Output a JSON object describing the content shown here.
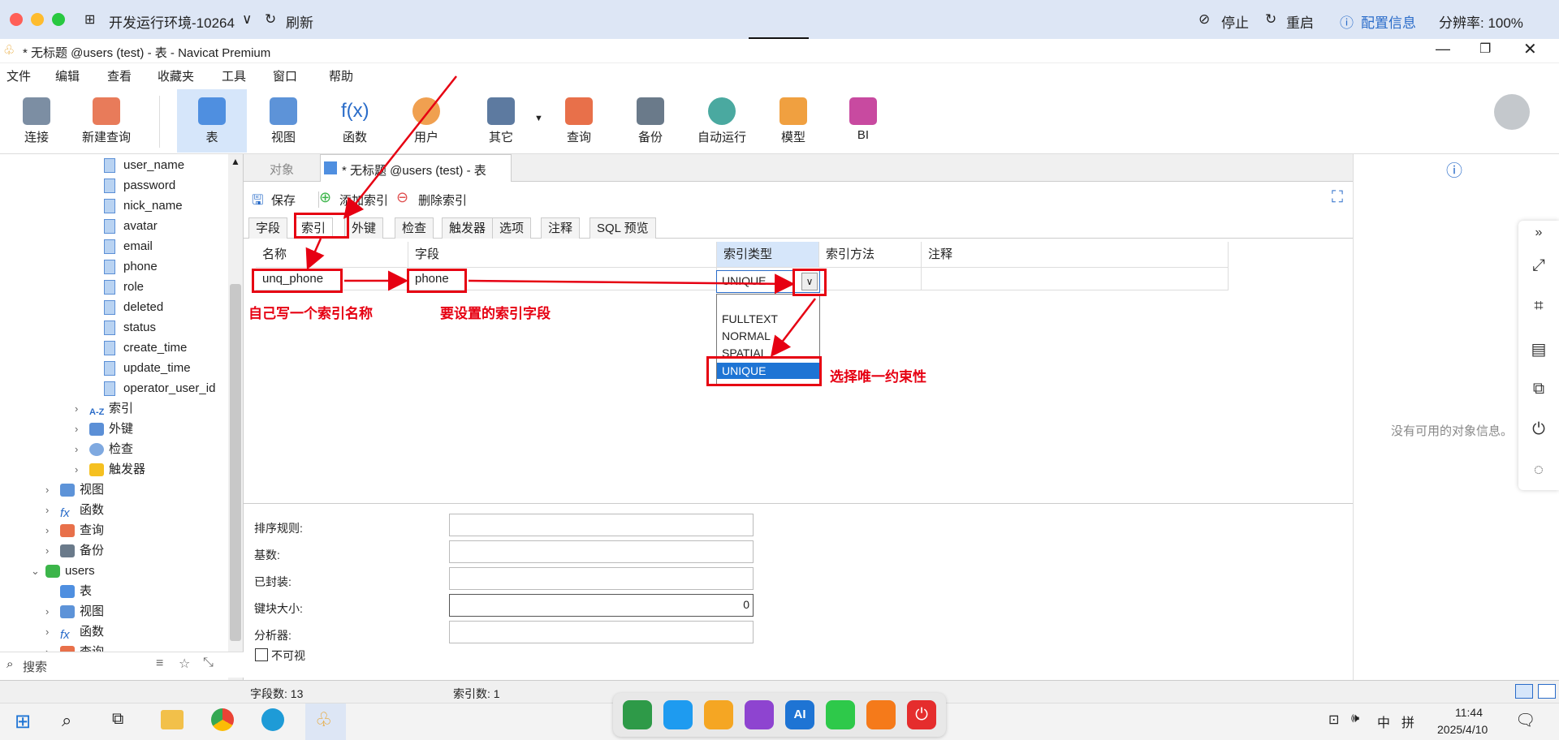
{
  "topbar": {
    "env": "开发运行环境-10264",
    "refresh": "刷新",
    "stop": "停止",
    "restart": "重启",
    "config": "配置信息",
    "resolution": "分辨率: 100%"
  },
  "window": {
    "title": "* 无标题 @users (test) - 表 - Navicat Premium"
  },
  "menu": [
    "文件",
    "编辑",
    "查看",
    "收藏夹",
    "工具",
    "窗口",
    "帮助"
  ],
  "toolbar": [
    {
      "label": "连接",
      "icon": "connect-icon"
    },
    {
      "label": "新建查询",
      "icon": "new-query-icon"
    },
    {
      "label": "表",
      "icon": "table-icon"
    },
    {
      "label": "视图",
      "icon": "view-icon"
    },
    {
      "label": "函数",
      "icon": "function-icon"
    },
    {
      "label": "用户",
      "icon": "user-icon"
    },
    {
      "label": "其它",
      "icon": "tools-icon"
    },
    {
      "label": "查询",
      "icon": "query-icon"
    },
    {
      "label": "备份",
      "icon": "backup-icon"
    },
    {
      "label": "自动运行",
      "icon": "robot-icon"
    },
    {
      "label": "模型",
      "icon": "model-icon"
    },
    {
      "label": "BI",
      "icon": "bi-icon"
    }
  ],
  "tree": {
    "fields": [
      "user_name",
      "password",
      "nick_name",
      "avatar",
      "email",
      "phone",
      "role",
      "deleted",
      "status",
      "create_time",
      "update_time",
      "operator_user_id"
    ],
    "table_groups": [
      "索引",
      "外键",
      "检查",
      "触发器"
    ],
    "db_groups": [
      "视图",
      "函数",
      "查询",
      "备份"
    ],
    "db": "users",
    "db_children": [
      "表",
      "视图",
      "函数",
      "查询"
    ],
    "search_placeholder": "搜索"
  },
  "tabs": {
    "objects": "对象",
    "active": "* 无标题 @users (test) - 表"
  },
  "subtool": {
    "save": "保存",
    "add_index": "添加索引",
    "delete_index": "删除索引"
  },
  "inner_tabs": [
    "字段",
    "索引",
    "外键",
    "检查",
    "触发器",
    "选项",
    "注释",
    "SQL 预览"
  ],
  "grid": {
    "headers": [
      "名称",
      "字段",
      "索引类型",
      "索引方法",
      "注释"
    ],
    "row": {
      "name": "unq_phone",
      "field": "phone",
      "type": "UNIQUE",
      "method": "",
      "comment": ""
    }
  },
  "dropdown": {
    "options": [
      "FULLTEXT",
      "NORMAL",
      "SPATIAL",
      "UNIQUE"
    ],
    "selected": "UNIQUE"
  },
  "annotations": {
    "name_hint": "自己写一个索引名称",
    "field_hint": "要设置的索引字段",
    "unique_hint": "选择唯一约束性"
  },
  "props": {
    "collation": "排序规则:",
    "cardinality": "基数:",
    "packed": "已封装:",
    "key_block": "键块大小:",
    "key_block_value": "0",
    "parser": "分析器:",
    "invisible": "不可视"
  },
  "right_panel": {
    "empty": "没有可用的对象信息。"
  },
  "status": {
    "field_count": "字段数: 13",
    "index_count": "索引数: 1"
  },
  "taskbar": {
    "time": "11:44",
    "date": "2025/4/10",
    "lang": "中",
    "ime": "拼"
  }
}
